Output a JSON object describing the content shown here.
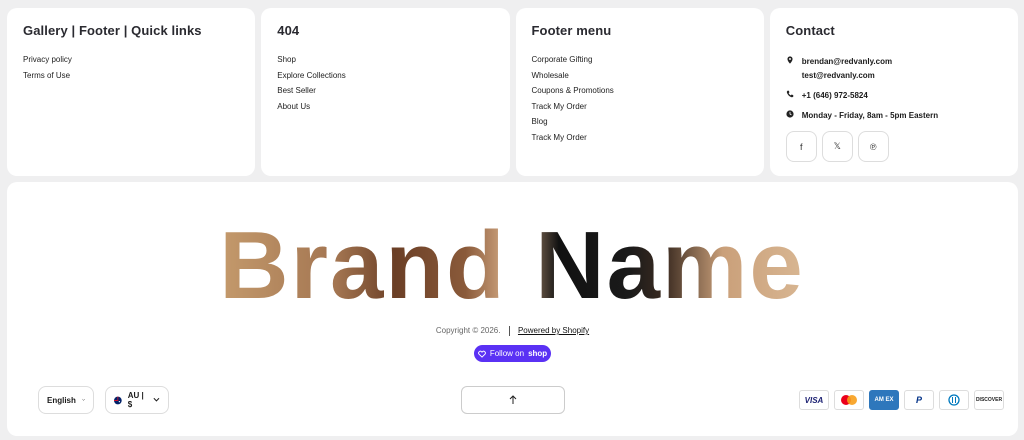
{
  "columns": [
    {
      "title": "Gallery | Footer | Quick links",
      "links": [
        "Privacy policy",
        "Terms of Use"
      ]
    },
    {
      "title": "404",
      "links": [
        "Shop",
        "Explore Collections",
        "Best Seller",
        "About Us"
      ]
    },
    {
      "title": "Footer menu",
      "links": [
        "Corporate Gifting",
        "Wholesale",
        "Coupons & Promotions",
        "Track My Order",
        "Blog",
        "Track My Order"
      ]
    }
  ],
  "contact": {
    "title": "Contact",
    "emails": [
      "brendan@redvanly.com",
      "test@redvanly.com"
    ],
    "phone": "+1 (646) 972-5824",
    "hours": "Monday - Friday, 8am - 5pm Eastern",
    "socials": [
      {
        "icon": "facebook-icon",
        "glyph": "f"
      },
      {
        "icon": "x-icon",
        "glyph": "𝕏"
      },
      {
        "icon": "pinterest-icon",
        "glyph": "℗"
      }
    ]
  },
  "brand": {
    "text": "Brand Name"
  },
  "footer": {
    "copyright": "Copyright © 2026.",
    "powered_by": "Powered by Shopify",
    "follow_label": "Follow on",
    "follow_brand": "shop"
  },
  "controls": {
    "language": "English",
    "currency": "AU | $"
  },
  "payments": [
    {
      "icon": "visa-icon",
      "label": "VISA",
      "color": "#1a1f71"
    },
    {
      "icon": "mastercard-icon",
      "label": "",
      "color": "#eb001b"
    },
    {
      "icon": "amex-icon",
      "label": "AM EX",
      "color": "#2e77bc"
    },
    {
      "icon": "paypal-icon",
      "label": "P",
      "color": "#003087"
    },
    {
      "icon": "diners-icon",
      "label": "D",
      "color": "#0079be"
    },
    {
      "icon": "discover-icon",
      "label": "DISCOVER",
      "color": "#f58220"
    }
  ]
}
